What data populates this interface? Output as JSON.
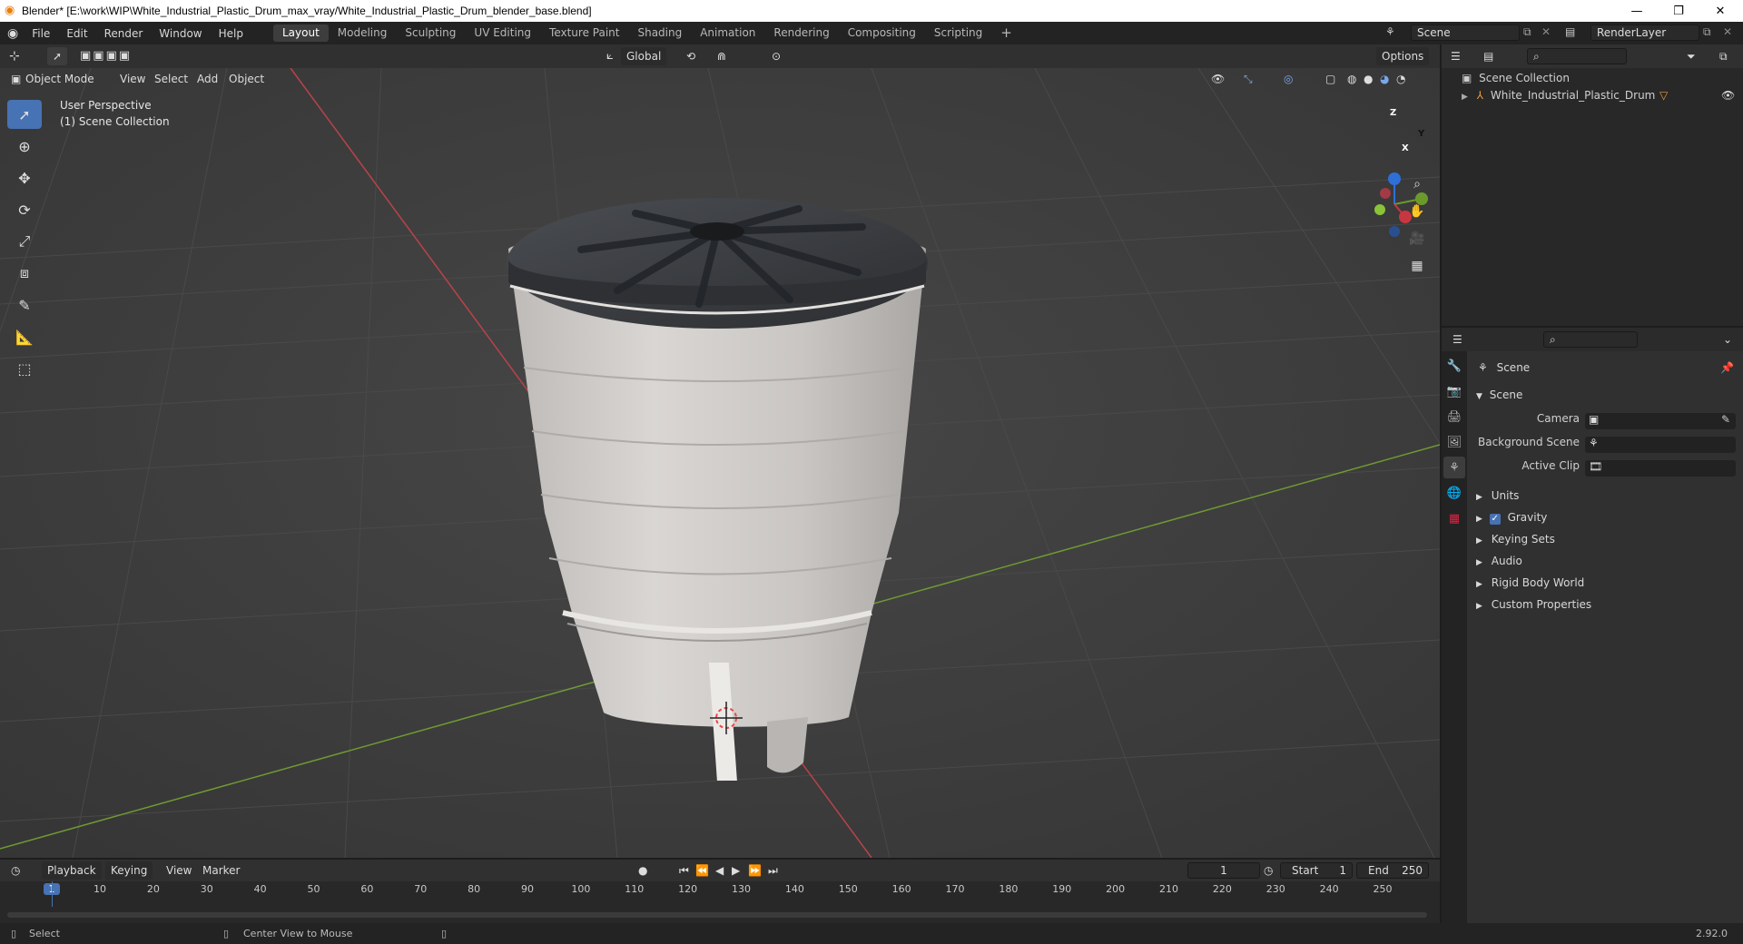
{
  "window": {
    "title": "Blender* [E:\\work\\WIP\\White_Industrial_Plastic_Drum_max_vray/White_Industrial_Plastic_Drum_blender_base.blend]",
    "minimize": "—",
    "restore": "❐",
    "close": "✕"
  },
  "menubar": {
    "items": [
      "File",
      "Edit",
      "Render",
      "Window",
      "Help"
    ],
    "workspaces": [
      "Layout",
      "Modeling",
      "Sculpting",
      "UV Editing",
      "Texture Paint",
      "Shading",
      "Animation",
      "Rendering",
      "Compositing",
      "Scripting"
    ],
    "add_workspace": "+",
    "scene_value": "Scene",
    "renderlayer_value": "RenderLayer"
  },
  "viewport_header": {
    "mode": "Object Mode",
    "menus": [
      "View",
      "Select",
      "Add",
      "Object"
    ],
    "transform_orientation": "Global",
    "options": "Options"
  },
  "viewport": {
    "perspective_label": "User Perspective",
    "collection_label": "(1) Scene Collection",
    "gizmo": {
      "z": "Z",
      "y": "Y",
      "x": "X"
    }
  },
  "outliner": {
    "root": "Scene Collection",
    "items": [
      {
        "name": "White_Industrial_Plastic_Drum"
      }
    ]
  },
  "properties": {
    "context_title": "Scene",
    "section_scene": "Scene",
    "fields": [
      {
        "label": "Camera",
        "value": ""
      },
      {
        "label": "Background Scene",
        "value": ""
      },
      {
        "label": "Active Clip",
        "value": ""
      }
    ],
    "subpanels": [
      "Units",
      "Gravity",
      "Keying Sets",
      "Audio",
      "Rigid Body World",
      "Custom Properties"
    ],
    "gravity_checked": true
  },
  "timeline": {
    "menus": [
      "Playback",
      "Keying",
      "View",
      "Marker"
    ],
    "current_frame": "1",
    "start_label": "Start",
    "start_value": "1",
    "end_label": "End",
    "end_value": "250",
    "ticks": [
      "1",
      "10",
      "20",
      "30",
      "40",
      "50",
      "60",
      "70",
      "80",
      "90",
      "100",
      "110",
      "120",
      "130",
      "140",
      "150",
      "160",
      "170",
      "180",
      "190",
      "200",
      "210",
      "220",
      "230",
      "240",
      "250"
    ]
  },
  "statusbar": {
    "left_action": "Select",
    "middle_action": "Center View to Mouse",
    "version": "2.92.0"
  },
  "colors": {
    "accent": "#4772b3",
    "x_axis": "#c8363f",
    "y_axis": "#6b9a2a",
    "z_axis": "#2f6fd8"
  }
}
